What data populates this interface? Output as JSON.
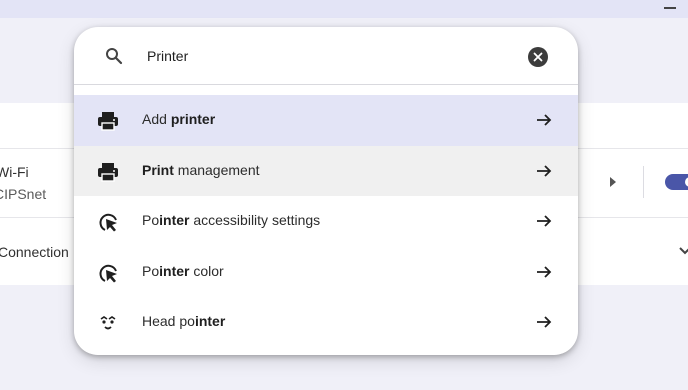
{
  "background": {
    "wifi_title": "Wi-Fi",
    "wifi_network": "CIPSnet",
    "connection_text": "Connection"
  },
  "search": {
    "query": "Printer",
    "search_icon": "search-icon",
    "clear_icon": "close-icon"
  },
  "results": [
    {
      "icon": "printer-icon",
      "pre": "Add ",
      "bold": "printer",
      "post": "",
      "state": "selected"
    },
    {
      "icon": "printer-icon",
      "pre": "",
      "bold": "Print",
      "post": " management",
      "state": "hover"
    },
    {
      "icon": "pointer-icon",
      "pre": "Po",
      "bold": "inter",
      "post": " accessibility settings",
      "state": ""
    },
    {
      "icon": "pointer-icon",
      "pre": "Po",
      "bold": "inter",
      "post": " color",
      "state": ""
    },
    {
      "icon": "head-pointer-icon",
      "pre": "Head po",
      "bold": "inter",
      "post": "",
      "state": ""
    }
  ],
  "colors": {
    "selected_row": "#e3e4f6",
    "hover_row": "#f0f0f0",
    "accent": "#4a56a8"
  }
}
